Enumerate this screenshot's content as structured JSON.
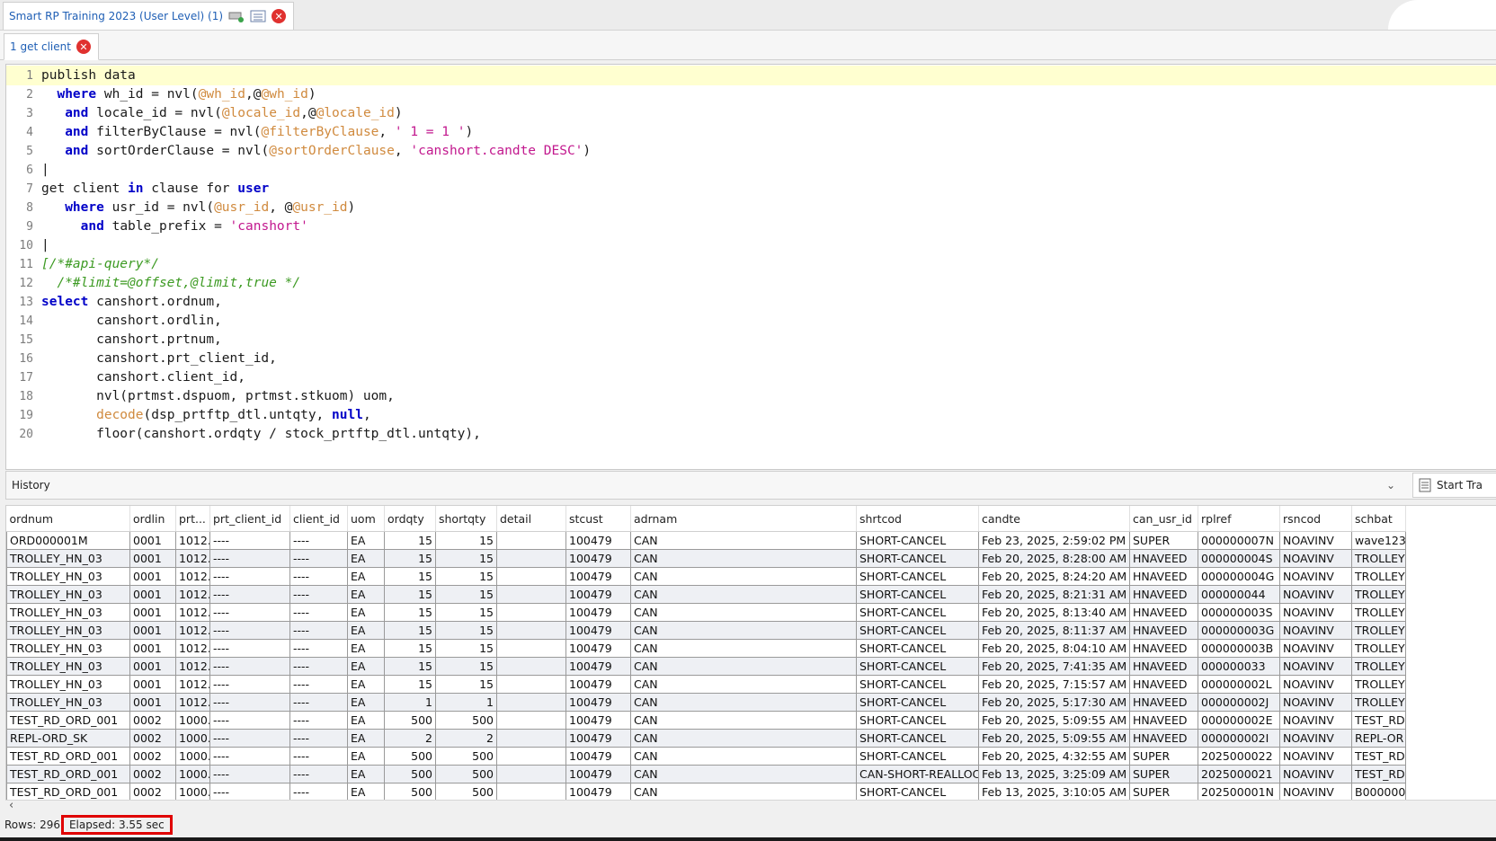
{
  "window": {
    "tab_title": "Smart RP Training 2023 (User Level) (1)",
    "tab_icons": [
      "server-icon",
      "list-icon"
    ],
    "close_icon": "close-icon"
  },
  "subtab": {
    "label": "1 get client"
  },
  "editor": {
    "current_line": 1,
    "lines": [
      {
        "n": "1",
        "tokens": [
          [
            "",
            "publish data"
          ]
        ]
      },
      {
        "n": "2",
        "tokens": [
          [
            "",
            "  "
          ],
          [
            "kw",
            "where"
          ],
          [
            "",
            " wh_id = nvl("
          ],
          [
            "var",
            "@wh_id"
          ],
          [
            "",
            ",@"
          ],
          [
            "var",
            "@wh_id"
          ],
          [
            "",
            ")"
          ]
        ]
      },
      {
        "n": "3",
        "tokens": [
          [
            "",
            "   "
          ],
          [
            "kw",
            "and"
          ],
          [
            "",
            " locale_id = nvl("
          ],
          [
            "var",
            "@locale_id"
          ],
          [
            "",
            ",@"
          ],
          [
            "var",
            "@locale_id"
          ],
          [
            "",
            ")"
          ]
        ]
      },
      {
        "n": "4",
        "tokens": [
          [
            "",
            "   "
          ],
          [
            "kw",
            "and"
          ],
          [
            "",
            " filterByClause = nvl("
          ],
          [
            "var",
            "@filterByClause"
          ],
          [
            "",
            ", "
          ],
          [
            "str",
            "' 1 = 1 '"
          ],
          [
            "",
            ")"
          ]
        ]
      },
      {
        "n": "5",
        "tokens": [
          [
            "",
            "   "
          ],
          [
            "kw",
            "and"
          ],
          [
            "",
            " sortOrderClause = nvl("
          ],
          [
            "var",
            "@sortOrderClause"
          ],
          [
            "",
            ", "
          ],
          [
            "str",
            "'canshort.candte DESC'"
          ],
          [
            "",
            ")"
          ]
        ]
      },
      {
        "n": "6",
        "tokens": [
          [
            "",
            "|"
          ]
        ]
      },
      {
        "n": "7",
        "tokens": [
          [
            "",
            "get client "
          ],
          [
            "kw",
            "in"
          ],
          [
            "",
            " clause for "
          ],
          [
            "kw",
            "user"
          ]
        ]
      },
      {
        "n": "8",
        "tokens": [
          [
            "",
            "   "
          ],
          [
            "kw",
            "where"
          ],
          [
            "",
            " usr_id = nvl("
          ],
          [
            "var",
            "@usr_id"
          ],
          [
            "",
            ", @"
          ],
          [
            "var",
            "@usr_id"
          ],
          [
            "",
            ")"
          ]
        ]
      },
      {
        "n": "9",
        "tokens": [
          [
            "",
            "     "
          ],
          [
            "kw",
            "and"
          ],
          [
            "",
            " table_prefix = "
          ],
          [
            "str",
            "'canshort'"
          ]
        ]
      },
      {
        "n": "10",
        "tokens": [
          [
            "",
            "|"
          ]
        ]
      },
      {
        "n": "11",
        "tokens": [
          [
            "cmt",
            "[/*#api-query*/"
          ]
        ]
      },
      {
        "n": "12",
        "tokens": [
          [
            "",
            "  "
          ],
          [
            "cmt",
            "/*#limit=@offset,@limit,true */"
          ]
        ]
      },
      {
        "n": "13",
        "tokens": [
          [
            "kw",
            "select"
          ],
          [
            "",
            " canshort.ordnum,"
          ]
        ]
      },
      {
        "n": "14",
        "tokens": [
          [
            "",
            "       canshort.ordlin,"
          ]
        ]
      },
      {
        "n": "15",
        "tokens": [
          [
            "",
            "       canshort.prtnum,"
          ]
        ]
      },
      {
        "n": "16",
        "tokens": [
          [
            "",
            "       canshort.prt_client_id,"
          ]
        ]
      },
      {
        "n": "17",
        "tokens": [
          [
            "",
            "       canshort.client_id,"
          ]
        ]
      },
      {
        "n": "18",
        "tokens": [
          [
            "",
            "       nvl(prtmst.dspuom, prtmst.stkuom) uom,"
          ]
        ]
      },
      {
        "n": "19",
        "tokens": [
          [
            "",
            "       "
          ],
          [
            "fn",
            "decode"
          ],
          [
            "",
            "(dsp_prtftp_dtl.untqty, "
          ],
          [
            "kw",
            "null"
          ],
          [
            "",
            ","
          ]
        ]
      },
      {
        "n": "20",
        "tokens": [
          [
            "",
            "       floor(canshort.ordqty / stock_prtftp_dtl.untqty),"
          ]
        ]
      }
    ]
  },
  "history": {
    "label": "History",
    "start_label": "Start Tra"
  },
  "grid": {
    "columns": [
      "ordnum",
      "ordlin",
      "prt...",
      "prt_client_id",
      "client_id",
      "uom",
      "ordqty",
      "shortqty",
      "detail",
      "stcust",
      "adrnam",
      "shrtcod",
      "candte",
      "can_usr_id",
      "rplref",
      "rsncod",
      "schbat"
    ],
    "rows": [
      [
        "ORD000001M",
        "0001",
        "1012...",
        "----",
        "----",
        "EA",
        "15",
        "15",
        "",
        "100479",
        "CAN",
        "SHORT-CANCEL",
        "Feb 23, 2025, 2:59:02 PM",
        "SUPER",
        "000000007N",
        "NOAVINV",
        "wave123"
      ],
      [
        "TROLLEY_HN_03",
        "0001",
        "1012...",
        "----",
        "----",
        "EA",
        "15",
        "15",
        "",
        "100479",
        "CAN",
        "SHORT-CANCEL",
        "Feb 20, 2025, 8:28:00 AM",
        "HNAVEED",
        "000000004S",
        "NOAVINV",
        "TROLLEY"
      ],
      [
        "TROLLEY_HN_03",
        "0001",
        "1012...",
        "----",
        "----",
        "EA",
        "15",
        "15",
        "",
        "100479",
        "CAN",
        "SHORT-CANCEL",
        "Feb 20, 2025, 8:24:20 AM",
        "HNAVEED",
        "000000004G",
        "NOAVINV",
        "TROLLEY"
      ],
      [
        "TROLLEY_HN_03",
        "0001",
        "1012...",
        "----",
        "----",
        "EA",
        "15",
        "15",
        "",
        "100479",
        "CAN",
        "SHORT-CANCEL",
        "Feb 20, 2025, 8:21:31 AM",
        "HNAVEED",
        "000000044",
        "NOAVINV",
        "TROLLEY"
      ],
      [
        "TROLLEY_HN_03",
        "0001",
        "1012...",
        "----",
        "----",
        "EA",
        "15",
        "15",
        "",
        "100479",
        "CAN",
        "SHORT-CANCEL",
        "Feb 20, 2025, 8:13:40 AM",
        "HNAVEED",
        "000000003S",
        "NOAVINV",
        "TROLLEY"
      ],
      [
        "TROLLEY_HN_03",
        "0001",
        "1012...",
        "----",
        "----",
        "EA",
        "15",
        "15",
        "",
        "100479",
        "CAN",
        "SHORT-CANCEL",
        "Feb 20, 2025, 8:11:37 AM",
        "HNAVEED",
        "000000003G",
        "NOAVINV",
        "TROLLEY"
      ],
      [
        "TROLLEY_HN_03",
        "0001",
        "1012...",
        "----",
        "----",
        "EA",
        "15",
        "15",
        "",
        "100479",
        "CAN",
        "SHORT-CANCEL",
        "Feb 20, 2025, 8:04:10 AM",
        "HNAVEED",
        "000000003B",
        "NOAVINV",
        "TROLLEY"
      ],
      [
        "TROLLEY_HN_03",
        "0001",
        "1012...",
        "----",
        "----",
        "EA",
        "15",
        "15",
        "",
        "100479",
        "CAN",
        "SHORT-CANCEL",
        "Feb 20, 2025, 7:41:35 AM",
        "HNAVEED",
        "000000033",
        "NOAVINV",
        "TROLLEY"
      ],
      [
        "TROLLEY_HN_03",
        "0001",
        "1012...",
        "----",
        "----",
        "EA",
        "15",
        "15",
        "",
        "100479",
        "CAN",
        "SHORT-CANCEL",
        "Feb 20, 2025, 7:15:57 AM",
        "HNAVEED",
        "000000002L",
        "NOAVINV",
        "TROLLEY"
      ],
      [
        "TROLLEY_HN_03",
        "0001",
        "1012...",
        "----",
        "----",
        "EA",
        "1",
        "1",
        "",
        "100479",
        "CAN",
        "SHORT-CANCEL",
        "Feb 20, 2025, 5:17:30 AM",
        "HNAVEED",
        "000000002J",
        "NOAVINV",
        "TROLLEY"
      ],
      [
        "TEST_RD_ORD_001",
        "0002",
        "1000...",
        "----",
        "----",
        "EA",
        "500",
        "500",
        "",
        "100479",
        "CAN",
        "SHORT-CANCEL",
        "Feb 20, 2025, 5:09:55 AM",
        "HNAVEED",
        "000000002E",
        "NOAVINV",
        "TEST_RD"
      ],
      [
        "REPL-ORD_SK",
        "0002",
        "1000...",
        "----",
        "----",
        "EA",
        "2",
        "2",
        "",
        "100479",
        "CAN",
        "SHORT-CANCEL",
        "Feb 20, 2025, 5:09:55 AM",
        "HNAVEED",
        "000000002I",
        "NOAVINV",
        "REPL-OR"
      ],
      [
        "TEST_RD_ORD_001",
        "0002",
        "1000...",
        "----",
        "----",
        "EA",
        "500",
        "500",
        "",
        "100479",
        "CAN",
        "SHORT-CANCEL",
        "Feb 20, 2025, 4:32:55 AM",
        "SUPER",
        "2025000022",
        "NOAVINV",
        "TEST_RD"
      ],
      [
        "TEST_RD_ORD_001",
        "0002",
        "1000...",
        "----",
        "----",
        "EA",
        "500",
        "500",
        "",
        "100479",
        "CAN",
        "CAN-SHORT-REALLOC",
        "Feb 13, 2025, 3:25:09 AM",
        "SUPER",
        "2025000021",
        "NOAVINV",
        "TEST_RD"
      ],
      [
        "TEST_RD_ORD_001",
        "0002",
        "1000...",
        "----",
        "----",
        "EA",
        "500",
        "500",
        "",
        "100479",
        "CAN",
        "SHORT-CANCEL",
        "Feb 13, 2025, 3:10:05 AM",
        "SUPER",
        "202500001N",
        "NOAVINV",
        "B000000"
      ]
    ]
  },
  "status": {
    "rows_text": "Rows: 296",
    "elapsed_text": "Elapsed: 3.55 sec"
  }
}
